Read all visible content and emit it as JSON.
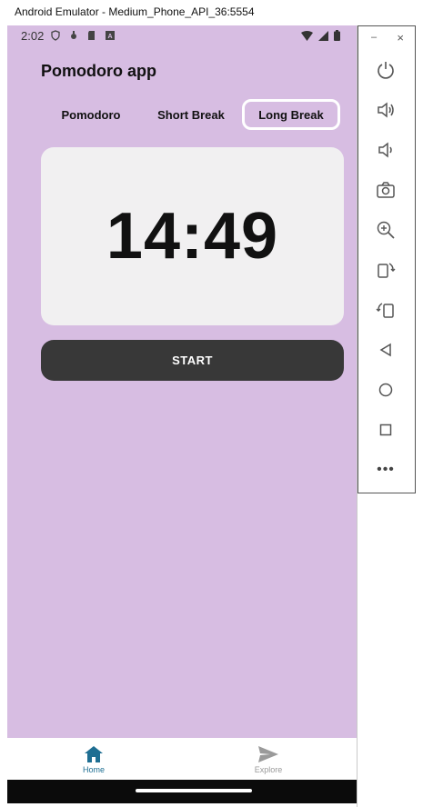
{
  "window": {
    "title": "Android Emulator - Medium_Phone_API_36:5554"
  },
  "status_bar": {
    "time": "2:02"
  },
  "app": {
    "title": "Pomodoro app",
    "tabs": [
      {
        "label": "Pomodoro",
        "selected": false
      },
      {
        "label": "Short Break",
        "selected": false
      },
      {
        "label": "Long Break",
        "selected": true
      }
    ],
    "timer": "14:49",
    "start_label": "START"
  },
  "bottom_nav": {
    "items": [
      {
        "label": "Home",
        "icon": "home-icon",
        "active": true
      },
      {
        "label": "Explore",
        "icon": "send-icon",
        "active": false
      }
    ]
  },
  "emulator_panel": {
    "minimize": "–",
    "close": "×",
    "more": "•••",
    "buttons": [
      "power-icon",
      "volume-up-icon",
      "volume-down-icon",
      "camera-icon",
      "zoom-in-icon",
      "rotate-left-icon",
      "rotate-right-icon",
      "back-icon",
      "home-circle-icon",
      "overview-icon",
      "more-icon"
    ]
  },
  "colors": {
    "app_background": "#d7bde2",
    "card": "#f1f0f1",
    "start_button": "#383838",
    "nav_active": "#1e6e92",
    "nav_inactive": "#9a9a9a"
  }
}
